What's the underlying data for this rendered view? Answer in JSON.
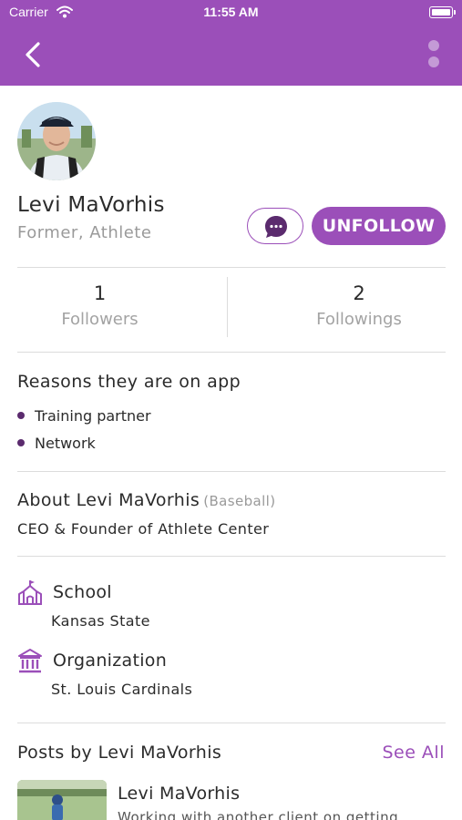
{
  "status_bar": {
    "carrier": "Carrier",
    "time": "11:55 AM"
  },
  "colors": {
    "brand_purple": "#9b4fb9",
    "bullet_dark": "#5b2b6e",
    "muted_gray": "#9a9a9a"
  },
  "icons": {
    "back": "chevron-left-icon",
    "more": "more-vertical-icon",
    "chat": "chat-bubble-icon",
    "school": "school-icon",
    "organization": "institution-icon"
  },
  "profile": {
    "name": "Levi MaVorhis",
    "role": "Former, Athlete"
  },
  "actions": {
    "unfollow_label": "UNFOLLOW"
  },
  "stats": {
    "followers_count": "1",
    "followers_label": "Followers",
    "followings_count": "2",
    "followings_label": "Followings"
  },
  "reasons": {
    "title": "Reasons they are on app",
    "items": [
      "Training partner",
      "Network"
    ]
  },
  "about": {
    "title": "About Levi MaVorhis",
    "sport": "(Baseball)",
    "text": "CEO & Founder of Athlete Center"
  },
  "school": {
    "title": "School",
    "value": "Kansas State"
  },
  "organization": {
    "title": "Organization",
    "value": "St. Louis Cardinals"
  },
  "posts": {
    "title": "Posts by Levi MaVorhis",
    "see_all": "See All",
    "items": [
      {
        "author": "Levi MaVorhis",
        "text": "Working with another client on getting"
      }
    ]
  }
}
